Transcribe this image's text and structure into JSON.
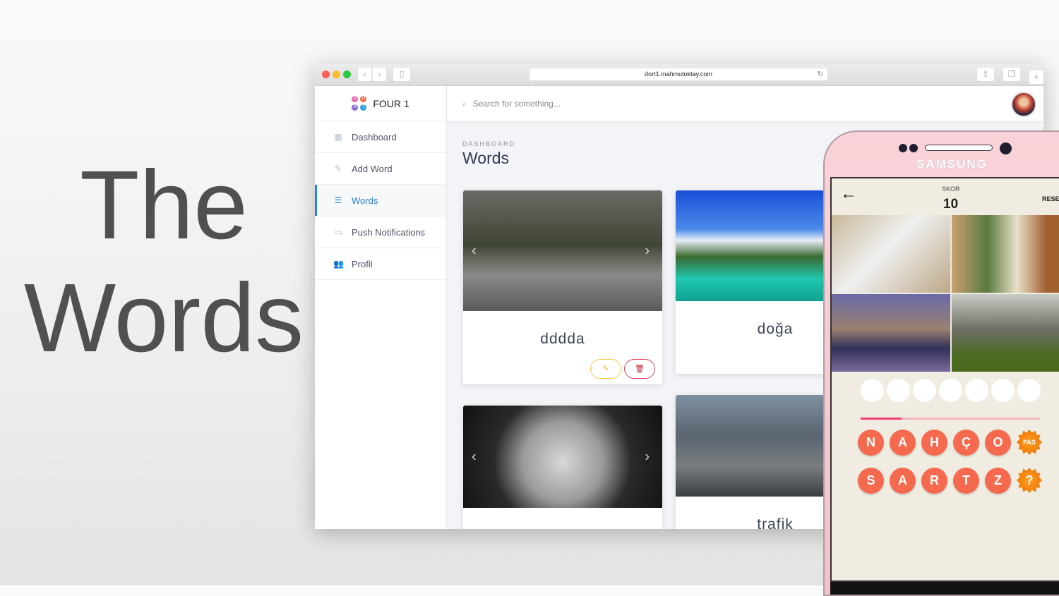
{
  "hero": {
    "line1": "The",
    "line2": "Words"
  },
  "browser": {
    "url": "dort1.mahmutoktay.com"
  },
  "app": {
    "brand": "FOUR 1",
    "logo_letters": [
      "D",
      "Ö",
      "R",
      "T"
    ],
    "search_placeholder": "Search for something...",
    "sidebar": [
      {
        "label": "Dashboard",
        "icon": "dashboard-icon"
      },
      {
        "label": "Add Word",
        "icon": "pencil-icon"
      },
      {
        "label": "Words",
        "icon": "list-icon",
        "active": true
      },
      {
        "label": "Push Notifications",
        "icon": "devices-icon"
      },
      {
        "label": "Profil",
        "icon": "users-icon"
      }
    ],
    "breadcrumb": "DASHBOARD",
    "page_title": "Words",
    "cards": [
      {
        "word": "dddda"
      },
      {
        "word": "doğa"
      },
      {
        "word": ""
      },
      {
        "word": "trafik"
      }
    ],
    "accent": "#2d7fd3"
  },
  "phone": {
    "brand": "SAMSUNG",
    "score_label": "SKOR",
    "score": "10",
    "reset_label": "RESET",
    "answer_slots": 7,
    "timer_progress_percent": 23,
    "letters_row1": [
      "N",
      "A",
      "H",
      "Ç",
      "O"
    ],
    "pass_label": "PAS",
    "letters_row2": [
      "S",
      "A",
      "R",
      "T",
      "Z"
    ],
    "hint_label": "?",
    "letter_color": "#f5694f"
  }
}
